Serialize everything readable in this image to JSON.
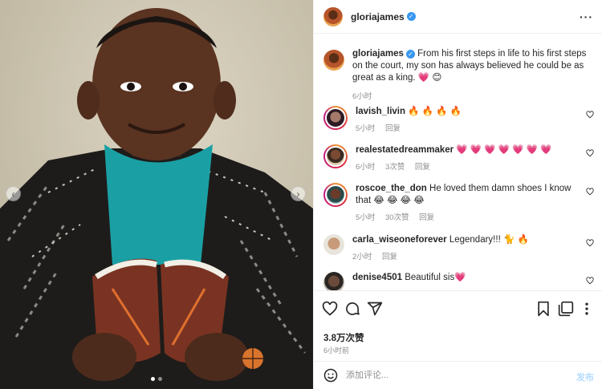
{
  "post": {
    "author": "gloriajames",
    "caption_text": "From his first steps in life to his first steps on the court, my son has always believed he could be as great as a king. 💗 😊",
    "caption_time": "6小时",
    "likes": "3.8万次赞",
    "posted_ago": "6小时前"
  },
  "comments": [
    {
      "user": "lavish_livin",
      "text": "🔥 🔥 🔥 🔥",
      "time": "5小时",
      "likes": "",
      "reply": "回复"
    },
    {
      "user": "realestatedreammaker",
      "text": "💗 💗 💗 💗 💗 💗 💗",
      "time": "6小时",
      "likes": "3次赞",
      "reply": "回复"
    },
    {
      "user": "roscoe_the_don",
      "text": "He loved them damn shoes I know that 😂 😂 😂 😂",
      "time": "5小时",
      "likes": "30次赞",
      "reply": "回复"
    },
    {
      "user": "carla_wiseoneforever",
      "text": "Legendary!!! 🐈 🔥",
      "time": "2小时",
      "likes": "",
      "reply": "回复"
    },
    {
      "user": "denise4501",
      "text": "Beautiful sis💗",
      "time": "",
      "likes": "",
      "reply": ""
    }
  ],
  "composer": {
    "placeholder": "添加评论...",
    "post_label": "发布"
  },
  "icons": {
    "more": "more-options-icon",
    "verified": "verified-badge-icon",
    "like": "heart-icon",
    "comment": "comment-icon",
    "share": "send-icon",
    "save": "bookmark-icon",
    "emoji": "emoji-icon",
    "prev": "chevron-left-icon",
    "next": "chevron-right-icon"
  },
  "colors": {
    "accent": "#3897f0",
    "text": "#262626",
    "muted": "#8e8e8e",
    "post_disabled": "#b3dbff"
  }
}
